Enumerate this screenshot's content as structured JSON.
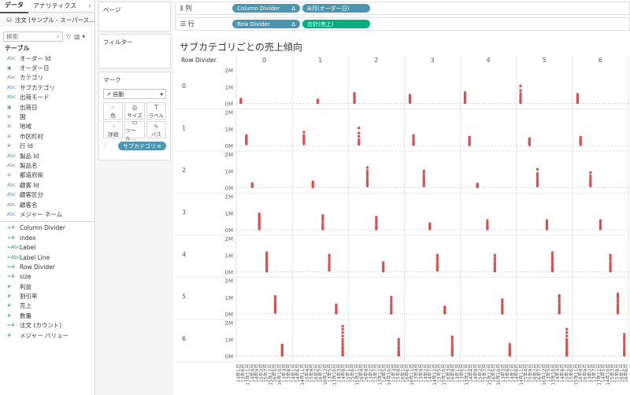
{
  "pane": {
    "tab_data": "データ",
    "tab_analytics": "アナリティクス",
    "collapse_icon": "chevron-left",
    "datasource": "注文 (サンプル - スーパース…",
    "search_placeholder": "検索",
    "fields_header": "テーブル",
    "dimensions": [
      {
        "type": "Abc",
        "name": "オーダー Id"
      },
      {
        "type": "▣",
        "name": "オーダー日"
      },
      {
        "type": "Abc",
        "name": "カテゴリ"
      },
      {
        "type": "Abc",
        "name": "サブカテゴリ"
      },
      {
        "type": "Abc",
        "name": "出荷モード"
      },
      {
        "type": "▣",
        "name": "出荷日"
      },
      {
        "type": "⊕",
        "name": "国"
      },
      {
        "type": "⊕",
        "name": "地域"
      },
      {
        "type": "⊕",
        "name": "市区町村"
      },
      {
        "type": "#",
        "name": "行 Id"
      },
      {
        "type": "Abc",
        "name": "製品 Id"
      },
      {
        "type": "Abc",
        "name": "製品名"
      },
      {
        "type": "⊕",
        "name": "都道府県"
      },
      {
        "type": "Abc",
        "name": "顧客 Id"
      },
      {
        "type": "Abc",
        "name": "顧客区分"
      },
      {
        "type": "Abc",
        "name": "顧客名"
      },
      {
        "type": "Abc",
        "name": "メジャー ネーム"
      }
    ],
    "measures": [
      {
        "type": "=#",
        "name": "Column Divider"
      },
      {
        "type": "=#",
        "name": "index"
      },
      {
        "type": "=Abc",
        "name": "Label"
      },
      {
        "type": "=Abc",
        "name": "Label Line"
      },
      {
        "type": "=#",
        "name": "Row Divider"
      },
      {
        "type": "=#",
        "name": "size"
      },
      {
        "type": "#",
        "name": "利益"
      },
      {
        "type": "#",
        "name": "割引率"
      },
      {
        "type": "#",
        "name": "売上"
      },
      {
        "type": "#",
        "name": "数量"
      },
      {
        "type": "=#",
        "name": "注文 (カウント)"
      },
      {
        "type": "#",
        "name": "メジャー バリュー"
      }
    ]
  },
  "cards": {
    "pages": "ページ",
    "filters": "フィルター",
    "marks": "マーク",
    "mark_type": "自動",
    "btn_color": "色",
    "btn_size": "サイズ",
    "btn_label": "ラベル",
    "btn_detail": "詳細",
    "btn_tooltip": "ツール…",
    "btn_path": "パス",
    "mark_pill": "サブカテゴリ"
  },
  "shelves": {
    "columns_label": "列",
    "rows_label": "行",
    "col_pill1": "Column Divider",
    "col_pill2": "月(オーダー日)",
    "row_pill1": "Row Divider",
    "row_pill2": "合計(売上)",
    "delta": "Δ"
  },
  "chart_data": {
    "type": "scatter",
    "title": "サブカテゴリごとの売上傾向",
    "row_header": "Row Divider",
    "columns": [
      "0",
      "1",
      "2",
      "3",
      "4",
      "5",
      "6"
    ],
    "rows": [
      "0",
      "1",
      "2",
      "3",
      "4",
      "5",
      "6"
    ],
    "y_ticks": [
      "2M",
      "1M",
      "0M"
    ],
    "ylim": [
      0,
      2000000
    ],
    "x_labels": [
      "13年1月",
      "13年6月",
      "13年11月",
      "14年4月",
      "14年9月",
      "15年2月",
      "15年7月",
      "15年12月",
      "16年5月",
      "16年10月",
      "13年3月",
      "13年8月",
      "14年1月",
      "14年6月",
      "14年11月",
      "15年4月",
      "15年9月",
      "16年2月",
      "16年7月",
      "16年12月",
      "13年5月",
      "13年10月",
      "14年3月",
      "14年8月",
      "15年1月",
      "15年6月",
      "15年11月",
      "16年4月",
      "16年9月",
      "13年2月",
      "13年7月",
      "13年12月",
      "14年5月",
      "14年10月",
      "15年3月",
      "15年8月",
      "16年1月",
      "16年6月",
      "16年11月",
      "13年4月",
      "13年9月",
      "14年2月",
      "14年7月",
      "14年12月",
      "15年5月",
      "15年10月",
      "16年3月",
      "16年8月",
      "13年1月",
      "13年6月",
      "13年11月",
      "14年4月",
      "14年9月",
      "15年2月",
      "15年7月",
      "15年12月",
      "16年5月",
      "16年10月",
      "13年3月",
      "13年8月",
      "14年1月",
      "14年6月",
      "14年11月",
      "15年4月",
      "15年9月",
      "16年2月",
      "16年7月",
      "16年12月",
      "13年5月",
      "13年10月",
      "14年3月",
      "14年8月",
      "15年1月",
      "15年6月",
      "15年11月",
      "16年4月",
      "16年9月",
      "13年2月",
      "13年7月",
      "13年12月",
      "14年5月",
      "14年10月",
      "15年3月",
      "15年8月",
      "16年1月",
      "16年6月"
    ],
    "marks": [
      {
        "row": 0,
        "col": 0,
        "x": 0.03,
        "v": [
          0.05,
          0.1,
          0.15,
          0.2,
          0.26
        ]
      },
      {
        "row": 0,
        "col": 1,
        "x": 0.45,
        "v": [
          0.05,
          0.1,
          0.15,
          0.2
        ]
      },
      {
        "row": 0,
        "col": 2,
        "x": 0.06,
        "v": [
          0.05,
          0.1,
          0.15,
          0.2,
          0.3,
          0.4,
          0.5,
          0.6
        ]
      },
      {
        "row": 0,
        "col": 3,
        "x": 0.05,
        "v": [
          0.05,
          0.1,
          0.15,
          0.22,
          0.3,
          0.4,
          0.5
        ]
      },
      {
        "row": 0,
        "col": 4,
        "x": 0.03,
        "v": [
          0.05,
          0.1,
          0.15,
          0.2,
          0.27,
          0.35,
          0.45,
          0.55,
          0.65
        ]
      },
      {
        "row": 0,
        "col": 5,
        "x": 0.02,
        "v": [
          0.05,
          0.12,
          0.2,
          0.3,
          0.45,
          0.6,
          0.78,
          1.05
        ]
      },
      {
        "row": 0,
        "col": 6,
        "x": 0.04,
        "v": [
          0.05,
          0.12,
          0.2,
          0.3,
          0.42,
          0.55
        ]
      },
      {
        "row": 1,
        "col": 0,
        "x": 0.14,
        "v": [
          0.1,
          0.15,
          0.2,
          0.25,
          0.3,
          0.35,
          0.4,
          0.45,
          0.5,
          0.55,
          0.6
        ]
      },
      {
        "row": 1,
        "col": 1,
        "x": 0.17,
        "v": [
          0.1,
          0.2,
          0.3,
          0.4,
          0.5,
          0.6,
          0.8
        ]
      },
      {
        "row": 1,
        "col": 2,
        "x": 0.15,
        "v": [
          0.08,
          0.2,
          0.35,
          0.55,
          0.75,
          1.05
        ]
      },
      {
        "row": 1,
        "col": 3,
        "x": 0.12,
        "v": [
          0.05,
          0.15,
          0.25,
          0.35,
          0.5,
          0.6
        ]
      },
      {
        "row": 1,
        "col": 4,
        "x": 0.12,
        "v": [
          0.05,
          0.12,
          0.2,
          0.3,
          0.4,
          0.5
        ]
      },
      {
        "row": 1,
        "col": 5,
        "x": 0.2,
        "v": [
          0.05,
          0.12,
          0.2,
          0.3,
          0.42
        ]
      },
      {
        "row": 1,
        "col": 6,
        "x": 0.1,
        "v": [
          0.05,
          0.12,
          0.2,
          0.3,
          0.4,
          0.5
        ]
      },
      {
        "row": 2,
        "col": 0,
        "x": 0.26,
        "v": [
          0.05,
          0.1,
          0.15,
          0.2,
          0.25
        ]
      },
      {
        "row": 2,
        "col": 1,
        "x": 0.35,
        "v": [
          0.05,
          0.1,
          0.15,
          0.2,
          0.28,
          0.35
        ]
      },
      {
        "row": 2,
        "col": 2,
        "x": 0.32,
        "v": [
          0.1,
          0.2,
          0.3,
          0.42,
          0.55,
          0.7,
          0.85,
          1.0,
          1.2
        ]
      },
      {
        "row": 2,
        "col": 3,
        "x": 0.33,
        "v": [
          0.1,
          0.2,
          0.3,
          0.4,
          0.5,
          0.6,
          0.72,
          0.88,
          1.0
        ]
      },
      {
        "row": 2,
        "col": 4,
        "x": 0.28,
        "v": [
          0.05,
          0.1,
          0.15,
          0.22
        ]
      },
      {
        "row": 2,
        "col": 5,
        "x": 0.36,
        "v": [
          0.1,
          0.2,
          0.3,
          0.42,
          0.55,
          0.7,
          0.85,
          1.1
        ]
      },
      {
        "row": 2,
        "col": 6,
        "x": 0.3,
        "v": [
          0.1,
          0.2,
          0.3,
          0.42,
          0.55,
          0.7,
          0.9
        ]
      },
      {
        "row": 3,
        "col": 0,
        "x": 0.4,
        "v": [
          0.05,
          0.15,
          0.25,
          0.35,
          0.45,
          0.55,
          0.65,
          0.75,
          0.85,
          0.95
        ]
      },
      {
        "row": 3,
        "col": 1,
        "x": 0.55,
        "v": [
          0.05,
          0.15,
          0.28,
          0.42,
          0.58,
          0.72,
          0.85
        ]
      },
      {
        "row": 3,
        "col": 2,
        "x": 0.5,
        "v": [
          0.05,
          0.15,
          0.25,
          0.38,
          0.5,
          0.62,
          0.75
        ]
      },
      {
        "row": 3,
        "col": 3,
        "x": 0.45,
        "v": [
          0.05,
          0.12,
          0.2,
          0.28,
          0.36
        ]
      },
      {
        "row": 3,
        "col": 4,
        "x": 0.48,
        "v": [
          0.05,
          0.12,
          0.2,
          0.3,
          0.42,
          0.55
        ]
      },
      {
        "row": 3,
        "col": 5,
        "x": 0.55,
        "v": [
          0.05,
          0.12,
          0.2,
          0.3,
          0.42,
          0.55
        ]
      },
      {
        "row": 3,
        "col": 6,
        "x": 0.5,
        "v": [
          0.05,
          0.12,
          0.2,
          0.3,
          0.42,
          0.55
        ]
      },
      {
        "row": 4,
        "col": 0,
        "x": 0.55,
        "v": [
          0.05,
          0.15,
          0.25,
          0.35,
          0.45,
          0.55,
          0.65,
          0.75,
          0.85,
          0.95,
          1.05,
          1.15
        ]
      },
      {
        "row": 4,
        "col": 1,
        "x": 0.68,
        "v": [
          0.1,
          0.2,
          0.32,
          0.45,
          0.58,
          0.72,
          0.86,
          1.0
        ]
      },
      {
        "row": 4,
        "col": 2,
        "x": 0.64,
        "v": [
          0.05,
          0.12,
          0.2,
          0.3,
          0.42,
          0.55
        ]
      },
      {
        "row": 4,
        "col": 3,
        "x": 0.6,
        "v": [
          0.1,
          0.2,
          0.3,
          0.42,
          0.55,
          0.7,
          0.85,
          1.0
        ]
      },
      {
        "row": 4,
        "col": 4,
        "x": 0.63,
        "v": [
          0.05,
          0.12,
          0.2,
          0.3,
          0.42,
          0.55,
          0.7,
          0.85,
          1.0
        ]
      },
      {
        "row": 4,
        "col": 5,
        "x": 0.66,
        "v": [
          0.05,
          0.12,
          0.2,
          0.3,
          0.42,
          0.55,
          0.7,
          0.85,
          1.0,
          1.15
        ]
      },
      {
        "row": 4,
        "col": 6,
        "x": 0.7,
        "v": [
          0.05,
          0.12,
          0.2,
          0.3,
          0.42,
          0.55,
          0.7,
          0.85,
          1.0
        ]
      },
      {
        "row": 5,
        "col": 0,
        "x": 0.72,
        "v": [
          0.1,
          0.2,
          0.3,
          0.4,
          0.5,
          0.62,
          0.75,
          0.9,
          1.05
        ]
      },
      {
        "row": 5,
        "col": 1,
        "x": 0.82,
        "v": [
          0.05,
          0.12,
          0.2,
          0.3,
          0.42,
          0.55
        ]
      },
      {
        "row": 5,
        "col": 2,
        "x": 0.8,
        "v": [
          0.05,
          0.12,
          0.2,
          0.3,
          0.42,
          0.55,
          0.7,
          0.85,
          1.0
        ]
      },
      {
        "row": 5,
        "col": 3,
        "x": 0.75,
        "v": [
          0.05,
          0.12,
          0.2,
          0.3,
          0.42
        ]
      },
      {
        "row": 5,
        "col": 4,
        "x": 0.78,
        "v": [
          0.05,
          0.12,
          0.2,
          0.3,
          0.42,
          0.55,
          0.7,
          0.85
        ]
      },
      {
        "row": 5,
        "col": 5,
        "x": 0.8,
        "v": [
          0.05,
          0.12,
          0.2,
          0.3,
          0.42,
          0.55,
          0.7,
          0.85,
          1.0,
          1.1
        ]
      },
      {
        "row": 5,
        "col": 6,
        "x": 0.85,
        "v": [
          0.05,
          0.12,
          0.2,
          0.3,
          0.42,
          0.55,
          0.7,
          0.85,
          1.0,
          1.1,
          1.2
        ]
      },
      {
        "row": 6,
        "col": 0,
        "x": 0.86,
        "v": [
          0.05,
          0.1,
          0.18,
          0.26,
          0.34,
          0.42,
          0.5,
          0.58,
          0.66
        ]
      },
      {
        "row": 6,
        "col": 1,
        "x": 0.95,
        "v": [
          0.05,
          0.12,
          0.2,
          0.3,
          0.42,
          0.55,
          0.7,
          0.85,
          1.0,
          1.2,
          1.4,
          1.6,
          1.78
        ]
      },
      {
        "row": 6,
        "col": 2,
        "x": 0.95,
        "v": [
          0.05,
          0.12,
          0.2,
          0.3,
          0.42,
          0.55,
          0.7,
          0.85,
          1.0
        ]
      },
      {
        "row": 6,
        "col": 3,
        "x": 0.9,
        "v": [
          0.05,
          0.12,
          0.2,
          0.3,
          0.42,
          0.55,
          0.7,
          0.85,
          1.0,
          1.15
        ]
      },
      {
        "row": 6,
        "col": 4,
        "x": 0.93,
        "v": [
          0.05,
          0.12,
          0.2,
          0.3,
          0.42,
          0.55,
          0.7
        ]
      },
      {
        "row": 6,
        "col": 5,
        "x": 0.95,
        "v": [
          0.05,
          0.15,
          0.25,
          0.38,
          0.5,
          0.62,
          0.75,
          0.88,
          1.0,
          1.2,
          1.4,
          1.6
        ]
      },
      {
        "row": 6,
        "col": 6,
        "x": 0.98,
        "v": [
          0.05,
          0.12,
          0.2,
          0.3,
          0.42,
          0.55,
          0.7,
          0.85,
          1.0,
          1.15,
          1.3
        ]
      }
    ],
    "mark_color": "#d94f4f"
  }
}
